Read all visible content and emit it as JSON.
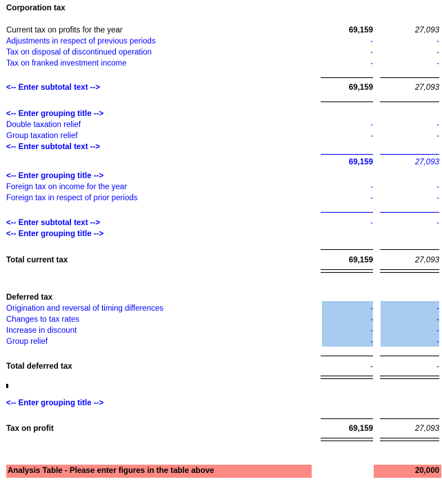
{
  "document": {
    "title": "Corporation tax",
    "placeholders": {
      "subtotal": "<-- Enter subtotal text -->",
      "grouping": "<-- Enter grouping title -->"
    },
    "dash": "-",
    "colors": {
      "link_blue": "#0000ff",
      "input_highlight": "#a8cbf0",
      "warning_bar": "#fd8a82",
      "text_black": "#000000"
    }
  },
  "sections": {
    "current_tax": {
      "rows": [
        {
          "label": "Current tax on profits for the year",
          "col1": "69,159",
          "col2": "27,093"
        },
        {
          "label": "Adjustments in respect of previous periods",
          "col1": "-",
          "col2": "-"
        },
        {
          "label": "Tax on disposal of discontinued operation",
          "col1": "-",
          "col2": "-"
        },
        {
          "label": "Tax on franked investment income",
          "col1": "-",
          "col2": "-"
        }
      ],
      "subtotal_1": {
        "label": "<-- Enter subtotal text -->",
        "col1": "69,159",
        "col2": "27,093"
      },
      "group_2_title": "<-- Enter grouping title -->",
      "group_2_rows": [
        {
          "label": "Double taxation relief",
          "col1": "-",
          "col2": "-"
        },
        {
          "label": "Group taxation relief",
          "col1": "-",
          "col2": "-"
        }
      ],
      "subtotal_2": {
        "label": "<-- Enter subtotal text -->",
        "col1": "69,159",
        "col2": "27,093"
      },
      "group_3_title": "<-- Enter grouping title -->",
      "group_3_rows": [
        {
          "label": "Foreign tax on income for the year",
          "col1": "-",
          "col2": "-"
        },
        {
          "label": "Foreign tax in respect of prior periods",
          "col1": "-",
          "col2": "-"
        }
      ],
      "subtotal_3": {
        "label": "<-- Enter subtotal text -->",
        "col1": "-",
        "col2": "-"
      },
      "group_4_title": "<-- Enter grouping title -->",
      "total": {
        "label": "Total current tax",
        "col1": "69,159",
        "col2": "27,093"
      }
    },
    "deferred_tax": {
      "title": "Deferred tax",
      "rows": [
        {
          "label": "Origination and reversal of timing differences",
          "col1": "-",
          "col2": "-"
        },
        {
          "label": "Changes to tax rates",
          "col1": "-",
          "col2": "-"
        },
        {
          "label": "Increase in discount",
          "col1": "-",
          "col2": "-"
        },
        {
          "label": "Group relief",
          "col1": "-",
          "col2": "-"
        }
      ],
      "total": {
        "label": "Total deferred tax",
        "col1": "-",
        "col2": "-"
      }
    },
    "footer": {
      "group_5_title": "<-- Enter grouping title -->",
      "total": {
        "label": "Tax on profit",
        "col1": "69,159",
        "col2": "27,093"
      }
    }
  },
  "warning": {
    "message": "Analysis Table - Please enter figures in the table above",
    "value": "20,000"
  }
}
